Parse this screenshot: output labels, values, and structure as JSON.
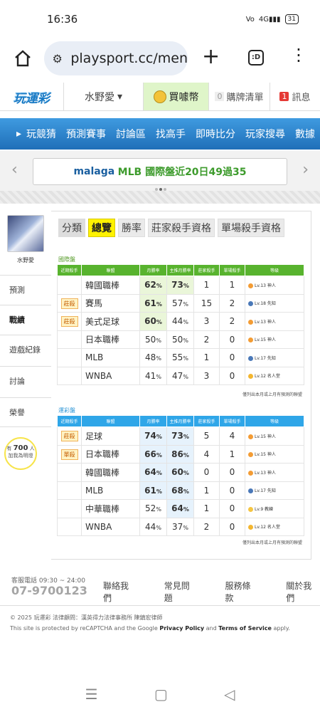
{
  "status": {
    "time": "16:36",
    "battery": "31",
    "signal": "4G"
  },
  "browser": {
    "url": "playsport.cc/men",
    "tab_count": ":D"
  },
  "site": {
    "logo": "玩運彩",
    "username": "水野愛",
    "coins_label": "買噱幣",
    "cart_count": "0",
    "cart_label": "購牌清單",
    "msg_count": "1",
    "msg_label": "訊息"
  },
  "nav": [
    "玩競猜",
    "預測賽事",
    "討論區",
    "找高手",
    "即時比分",
    "玩家搜尋",
    "數據"
  ],
  "ticker": {
    "user": "malaga",
    "text": "MLB 國際盤近20日49過35"
  },
  "sidebar": {
    "username": "水野愛",
    "items": [
      "預測",
      "戰績",
      "遊戲紀錄",
      "討論",
      "榮譽"
    ],
    "fans_prefix": "有",
    "fans_count": "700",
    "fans_suffix": "人",
    "fans_line2": "加我為明燈"
  },
  "tabs": {
    "label": "分類",
    "items": [
      "總覽",
      "勝率",
      "莊家殺手資格",
      "單場殺手資格"
    ]
  },
  "headers": [
    "近期殺手",
    "聯盟",
    "月勝率",
    "主推月勝率",
    "莊家殺手",
    "單場殺手",
    "等級"
  ],
  "intl": {
    "title": "國際盤",
    "rows": [
      {
        "tag": "",
        "league": "韓國職棒",
        "rate": "62",
        "rate_hot": true,
        "main": "73",
        "main_hot": true,
        "banker": "1",
        "single": "1",
        "level": "Lv.13 神人",
        "lvcolor": "#f39c34"
      },
      {
        "tag": "莊殺",
        "league": "賽馬",
        "rate": "61",
        "rate_hot": true,
        "main": "57",
        "main_hot": false,
        "banker": "15",
        "single": "2",
        "level": "Lv.18 先知",
        "lvcolor": "#4a78b8"
      },
      {
        "tag": "莊殺",
        "league": "美式足球",
        "rate": "60",
        "rate_hot": true,
        "main": "44",
        "main_hot": false,
        "banker": "3",
        "single": "2",
        "level": "Lv.13 神人",
        "lvcolor": "#f39c34"
      },
      {
        "tag": "",
        "league": "日本職棒",
        "rate": "50",
        "rate_hot": false,
        "main": "50",
        "main_hot": false,
        "banker": "2",
        "single": "0",
        "level": "Lv.15 神人",
        "lvcolor": "#f39c34"
      },
      {
        "tag": "",
        "league": "MLB",
        "rate": "48",
        "rate_hot": false,
        "main": "55",
        "main_hot": false,
        "banker": "1",
        "single": "0",
        "level": "Lv.17 先知",
        "lvcolor": "#4a78b8"
      },
      {
        "tag": "",
        "league": "WNBA",
        "rate": "41",
        "rate_hot": false,
        "main": "47",
        "main_hot": false,
        "banker": "3",
        "single": "0",
        "level": "Lv.12 名人堂",
        "lvcolor": "#f3b630"
      }
    ],
    "note": "僅列出本月或上月有預測的聯盟"
  },
  "lottery": {
    "title": "運彩盤",
    "rows": [
      {
        "tag": "莊殺",
        "league": "足球",
        "rate": "74",
        "rate_hot": true,
        "main": "73",
        "main_hot": true,
        "banker": "5",
        "single": "4",
        "level": "Lv.15 神人",
        "lvcolor": "#f39c34"
      },
      {
        "tag": "單殺",
        "league": "日本職棒",
        "rate": "66",
        "rate_hot": true,
        "main": "86",
        "main_hot": true,
        "banker": "4",
        "single": "1",
        "level": "Lv.15 神人",
        "lvcolor": "#f39c34"
      },
      {
        "tag": "",
        "league": "韓國職棒",
        "rate": "64",
        "rate_hot": true,
        "main": "60",
        "main_hot": true,
        "banker": "0",
        "single": "0",
        "level": "Lv.13 神人",
        "lvcolor": "#f39c34"
      },
      {
        "tag": "",
        "league": "MLB",
        "rate": "61",
        "rate_hot": true,
        "main": "68",
        "main_hot": true,
        "banker": "1",
        "single": "0",
        "level": "Lv.17 先知",
        "lvcolor": "#4a78b8"
      },
      {
        "tag": "",
        "league": "中華職棒",
        "rate": "52",
        "rate_hot": false,
        "main": "64",
        "main_hot": true,
        "banker": "1",
        "single": "0",
        "level": "Lv.9 教練",
        "lvcolor": "#f5c542"
      },
      {
        "tag": "",
        "league": "WNBA",
        "rate": "44",
        "rate_hot": false,
        "main": "37",
        "main_hot": false,
        "banker": "2",
        "single": "0",
        "level": "Lv.12 名人堂",
        "lvcolor": "#f3b630"
      }
    ],
    "note": "僅列出本月或上月有預測的聯盟"
  },
  "footer": {
    "service_hours": "客服電話 09:30 ~ 24:00",
    "phone": "07-9700123",
    "links": [
      "聯絡我們",
      "常見問題",
      "服務條款",
      "關於我們"
    ],
    "copyright": "© 2025 玩運彩 法律顧問：漢英得力法律事務所 陳鎮宏律師",
    "recaptcha_prefix": "This site is protected by reCAPTCHA and the Google",
    "privacy": "Privacy Policy",
    "and": "and",
    "terms": "Terms of Service",
    "apply": "apply."
  }
}
